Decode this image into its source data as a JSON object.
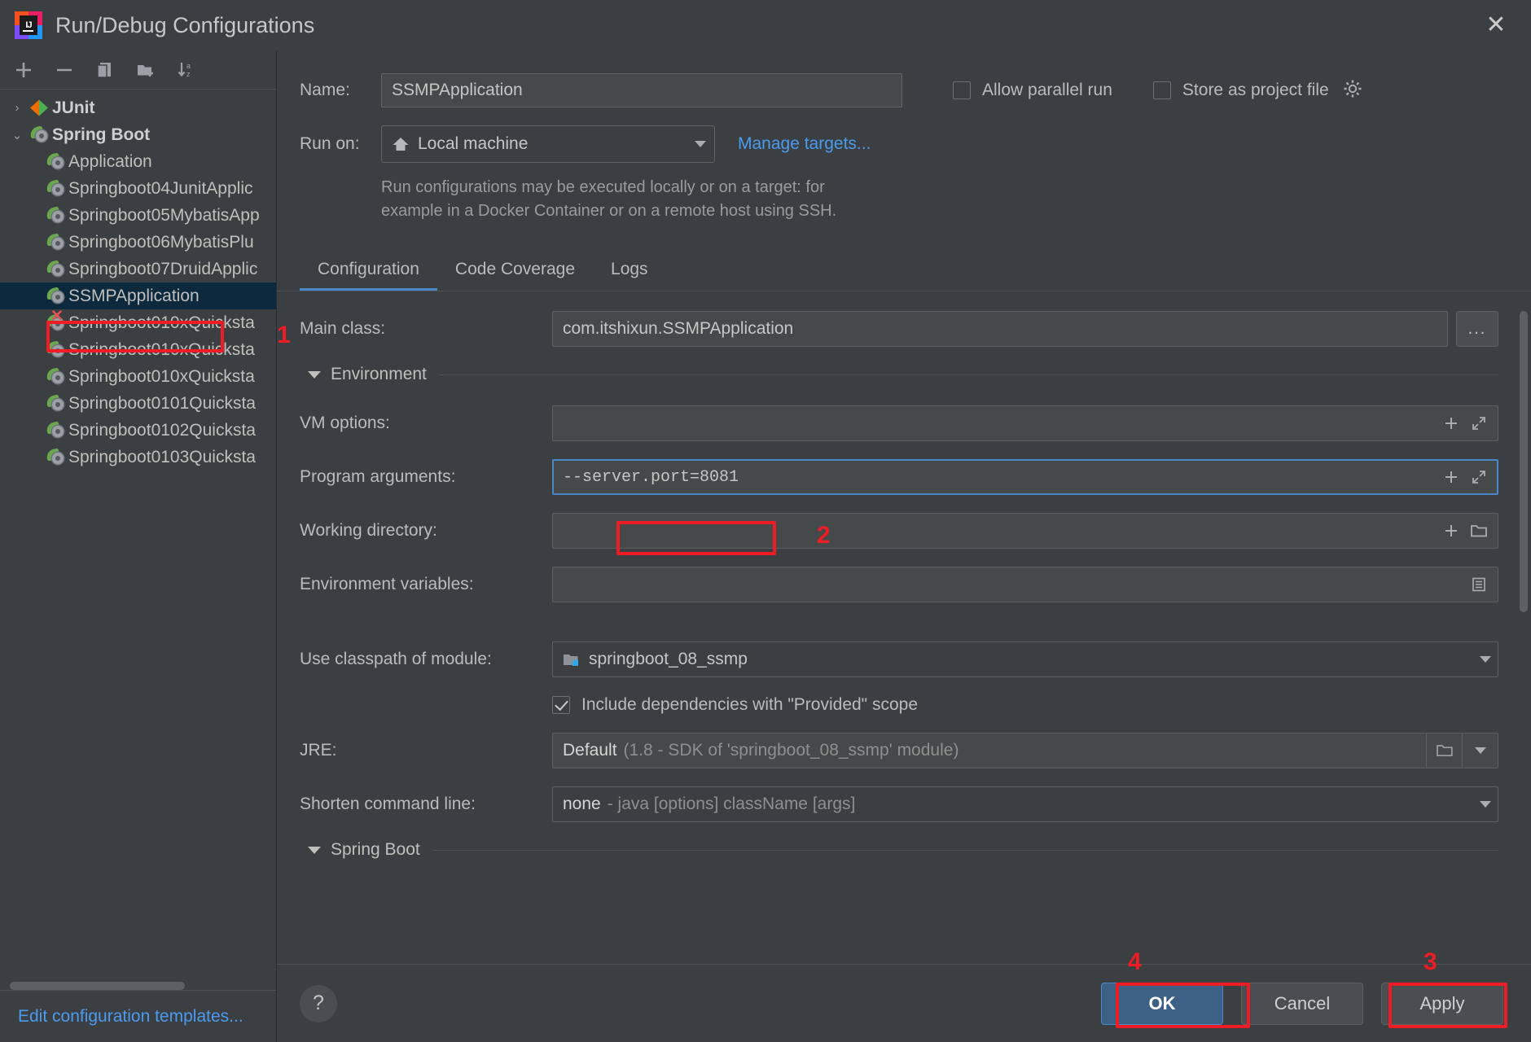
{
  "window": {
    "title": "Run/Debug Configurations",
    "logo_text": "IJ",
    "close_icon": "close-icon"
  },
  "left_toolbar": {
    "buttons": [
      {
        "name": "add-configuration-button",
        "icon": "plus-icon"
      },
      {
        "name": "remove-configuration-button",
        "icon": "minus-icon"
      },
      {
        "name": "copy-configuration-button",
        "icon": "copy-icon"
      },
      {
        "name": "new-folder-button",
        "icon": "folder-add-icon"
      },
      {
        "name": "sort-configurations-button",
        "icon": "sort-alphabetical-icon"
      }
    ]
  },
  "tree": {
    "groups": [
      {
        "label": "JUnit",
        "icon": "junit-icon",
        "expanded": false,
        "twisty": "›"
      },
      {
        "label": "Spring Boot",
        "icon": "spring-boot-icon",
        "expanded": true,
        "twisty": "⌄"
      }
    ],
    "items": [
      {
        "label": "Application",
        "icon": "spring-boot-icon",
        "selected": false,
        "error": false
      },
      {
        "label": "Springboot04JunitApplic",
        "icon": "spring-boot-icon",
        "selected": false,
        "error": false
      },
      {
        "label": "Springboot05MybatisApp",
        "icon": "spring-boot-icon",
        "selected": false,
        "error": false
      },
      {
        "label": "Springboot06MybatisPlu",
        "icon": "spring-boot-icon",
        "selected": false,
        "error": false
      },
      {
        "label": "Springboot07DruidApplic",
        "icon": "spring-boot-icon",
        "selected": false,
        "error": false
      },
      {
        "label": "SSMPApplication",
        "icon": "spring-boot-icon",
        "selected": true,
        "error": false
      },
      {
        "label": "Springboot010xQuicksta",
        "icon": "spring-boot-icon",
        "selected": false,
        "error": true
      },
      {
        "label": "Springboot010xQuicksta",
        "icon": "spring-boot-icon",
        "selected": false,
        "error": false
      },
      {
        "label": "Springboot010xQuicksta",
        "icon": "spring-boot-icon",
        "selected": false,
        "error": false
      },
      {
        "label": "Springboot0101Quicksta",
        "icon": "spring-boot-icon",
        "selected": false,
        "error": false
      },
      {
        "label": "Springboot0102Quicksta",
        "icon": "spring-boot-icon",
        "selected": false,
        "error": false
      },
      {
        "label": "Springboot0103Quicksta",
        "icon": "spring-boot-icon",
        "selected": false,
        "error": false
      }
    ],
    "edit_templates_link": "Edit configuration templates..."
  },
  "header": {
    "name_label": "Name:",
    "name_value": "SSMPApplication",
    "allow_parallel_run": {
      "label": "Allow parallel run",
      "checked": false
    },
    "store_as_project_file": {
      "label": "Store as project file",
      "checked": false
    },
    "gear_icon": "gear-icon",
    "run_on_label": "Run on:",
    "run_on_value": "Local machine",
    "run_on_icon": "home-icon",
    "manage_targets_link": "Manage targets...",
    "run_on_description_line1": "Run configurations may be executed locally or on a target: for",
    "run_on_description_line2": "example in a Docker Container or on a remote host using SSH."
  },
  "tabs": [
    {
      "label": "Configuration",
      "active": true
    },
    {
      "label": "Code Coverage",
      "active": false
    },
    {
      "label": "Logs",
      "active": false
    }
  ],
  "form": {
    "main_class": {
      "label": "Main class:",
      "value": "com.itshixun.SSMPApplication",
      "browse_button": "..."
    },
    "environment_section": {
      "label": "Environment",
      "expanded": true
    },
    "vm_options": {
      "label": "VM options:",
      "value": "",
      "macro_icon": "plus-icon",
      "expand_icon": "expand-icon"
    },
    "program_arguments": {
      "label": "Program arguments:",
      "value": "--server.port=8081",
      "macro_icon": "plus-icon",
      "expand_icon": "expand-icon"
    },
    "working_directory": {
      "label": "Working directory:",
      "value": "",
      "macro_icon": "plus-icon",
      "browse_icon": "folder-icon"
    },
    "environment_variables": {
      "label": "Environment variables:",
      "value": "",
      "browse_icon": "list-icon"
    },
    "classpath_module": {
      "label": "Use classpath of module:",
      "value": "springboot_08_ssmp",
      "icon": "module-icon"
    },
    "include_provided": {
      "label": "Include dependencies with \"Provided\" scope",
      "checked": true
    },
    "jre": {
      "label": "JRE:",
      "value_strong": "Default",
      "value_dim": "(1.8 - SDK of 'springboot_08_ssmp' module)",
      "browse_icon": "folder-icon"
    },
    "shorten_command_line": {
      "label": "Shorten command line:",
      "value_strong": "none",
      "value_dim": "- java [options] className [args]"
    },
    "spring_boot_section": {
      "label": "Spring Boot",
      "expanded": true
    }
  },
  "footer": {
    "help_icon": "help-icon",
    "ok_label": "OK",
    "cancel_label": "Cancel",
    "apply_label": "Apply"
  },
  "annotations": [
    {
      "number": "1",
      "target": "tree-item-ssmpapplication"
    },
    {
      "number": "2",
      "target": "program-arguments-value"
    },
    {
      "number": "3",
      "target": "apply-button"
    },
    {
      "number": "4",
      "target": "ok-button"
    }
  ],
  "colors": {
    "accent_blue": "#4a88c7",
    "link_blue": "#4a9bf0",
    "annotation_red": "#ee1c25",
    "selection_bg": "#0d293e",
    "panel_bg": "#3c3f41",
    "field_bg": "#45494a"
  }
}
